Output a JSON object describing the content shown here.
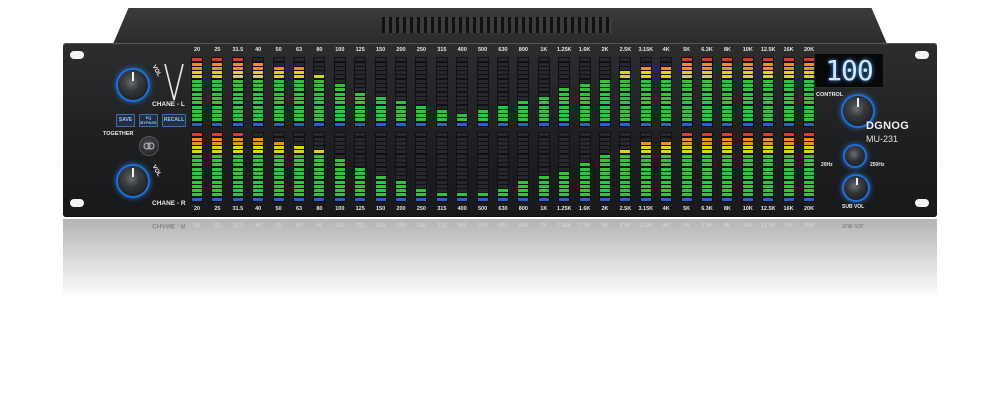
{
  "device": {
    "brand": "DGNOG",
    "model": "MU-231",
    "display_value": "100",
    "labels": {
      "chane_l": "CHANE - L",
      "chane_r": "CHANE - R",
      "together": "TOGETHER",
      "control": "CONTROL",
      "vol": "VOL",
      "hz20": "20Hz",
      "hz250": "250Hz",
      "sub_vol": "SUB VOL"
    },
    "buttons": {
      "save": "SAVE",
      "mid": "EQ BYPASS",
      "recall": "RECALL"
    },
    "frequencies": [
      "20",
      "25",
      "31.5",
      "40",
      "50",
      "63",
      "80",
      "100",
      "125",
      "150",
      "200",
      "250",
      "315",
      "400",
      "500",
      "630",
      "800",
      "1K",
      "1.25K",
      "1.6K",
      "2K",
      "2.5K",
      "3.15K",
      "4K",
      "5K",
      "6.3K",
      "8K",
      "10K",
      "12.5K",
      "16K",
      "20K"
    ],
    "levels_left": [
      1.0,
      1.0,
      1.0,
      0.95,
      0.9,
      0.85,
      0.75,
      0.65,
      0.5,
      0.45,
      0.4,
      0.3,
      0.25,
      0.2,
      0.25,
      0.3,
      0.35,
      0.45,
      0.55,
      0.65,
      0.7,
      0.8,
      0.85,
      0.9,
      1.0,
      1.0,
      1.0,
      1.0,
      1.0,
      1.0,
      1.0
    ],
    "levels_right": [
      1.0,
      1.0,
      1.0,
      0.95,
      0.9,
      0.8,
      0.75,
      0.6,
      0.5,
      0.4,
      0.3,
      0.2,
      0.15,
      0.1,
      0.15,
      0.2,
      0.3,
      0.35,
      0.45,
      0.55,
      0.7,
      0.75,
      0.85,
      0.9,
      1.0,
      1.0,
      1.0,
      1.0,
      1.0,
      1.0,
      1.0
    ],
    "colors": {
      "knob_ring": "#1e6fd8",
      "seg_red": "#e23b2e",
      "seg_orange": "#f28c1e",
      "seg_yellow": "#d9d41c",
      "seg_green": "#2fc43a",
      "seg_blue": "#2a5fd6",
      "seg_off": "#26282b",
      "display_text": "#cfe6ff"
    }
  }
}
